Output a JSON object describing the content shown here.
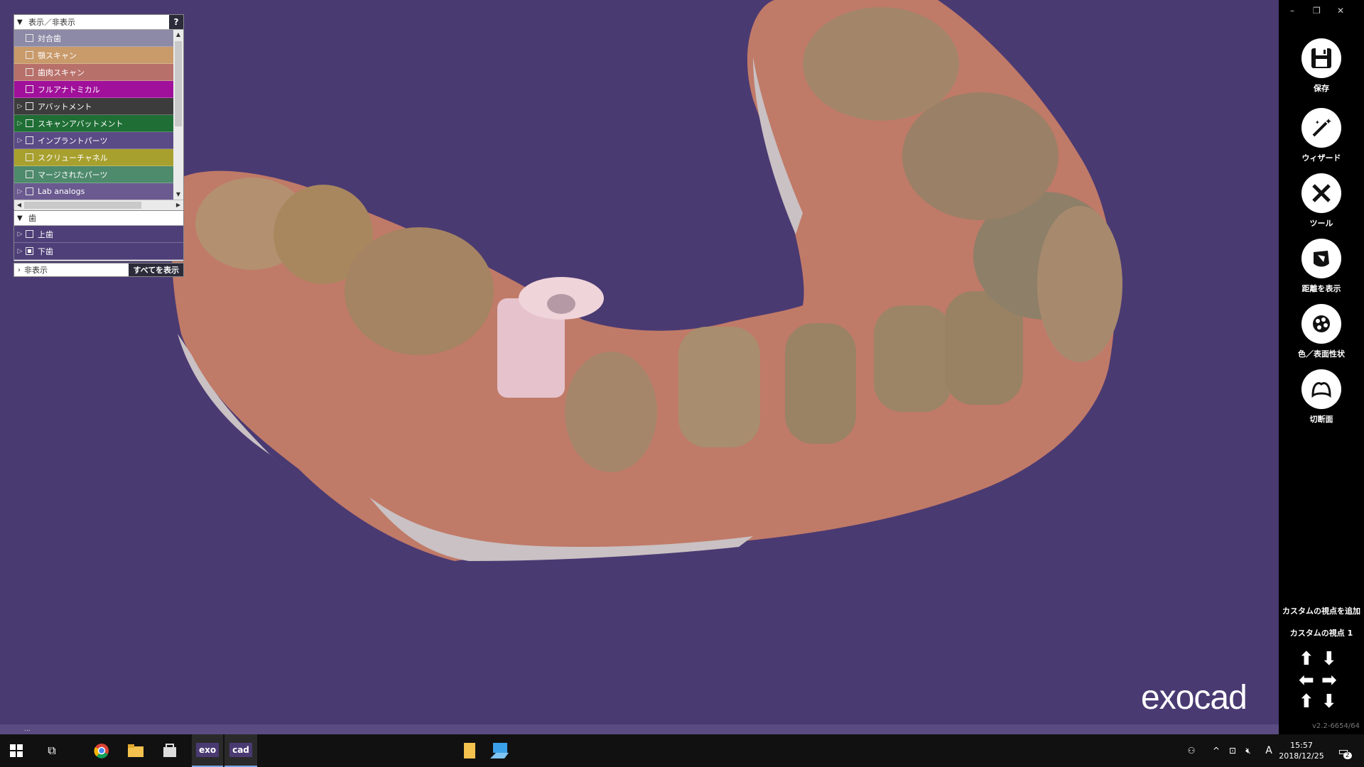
{
  "panel": {
    "header_label": "表示／非表示",
    "help_label": "?",
    "items": [
      {
        "label": "対合歯",
        "color": "#8c8aa6",
        "expandable": false,
        "checked": false
      },
      {
        "label": "顎スキャン",
        "color": "#c99a6a",
        "expandable": false,
        "checked": false
      },
      {
        "label": "歯肉スキャン",
        "color": "#b8706a",
        "expandable": false,
        "checked": false
      },
      {
        "label": "フルアナトミカル",
        "color": "#a0109a",
        "expandable": false,
        "checked": false
      },
      {
        "label": "アバットメント",
        "color": "#3c3c3c",
        "expandable": true,
        "checked": false
      },
      {
        "label": "スキャンアバットメント",
        "color": "#1f6e35",
        "expandable": true,
        "checked": false
      },
      {
        "label": "インプラントパーツ",
        "color": "#5a4a85",
        "expandable": true,
        "checked": false
      },
      {
        "label": "スクリューチャネル",
        "color": "#a8a02e",
        "expandable": false,
        "checked": false
      },
      {
        "label": "マージされたパーツ",
        "color": "#4e8a6c",
        "expandable": false,
        "checked": false
      },
      {
        "label": "Lab analogs",
        "color": "#6a5a90",
        "expandable": true,
        "checked": false
      }
    ],
    "teeth_header": "歯",
    "teeth": [
      {
        "label": "上歯",
        "checked": false
      },
      {
        "label": "下歯",
        "checked": true
      }
    ],
    "hidden_label": "非表示",
    "show_all_label": "すべてを表示"
  },
  "toolbar": {
    "tools": [
      {
        "label": "保存",
        "icon": "save-icon"
      },
      {
        "label": "ウィザード",
        "icon": "magic-wand-icon"
      },
      {
        "label": "ツール",
        "icon": "tools-icon"
      },
      {
        "label": "距離を表示",
        "icon": "distance-icon"
      },
      {
        "label": "色／表面性状",
        "icon": "palette-icon"
      },
      {
        "label": "切断面",
        "icon": "clipping-plane-icon"
      }
    ],
    "add_custom_view": "カスタムの視点を追加",
    "custom_view_1": "カスタムの視点 1",
    "version": "v2.2-6654/64"
  },
  "logo": "exocad",
  "status_text": "...",
  "taskbar": {
    "apps": [
      {
        "label": "exo"
      },
      {
        "label": "cad"
      }
    ],
    "ime": "A",
    "time": "15:57",
    "date": "2018/12/25",
    "notification_count": "2"
  }
}
